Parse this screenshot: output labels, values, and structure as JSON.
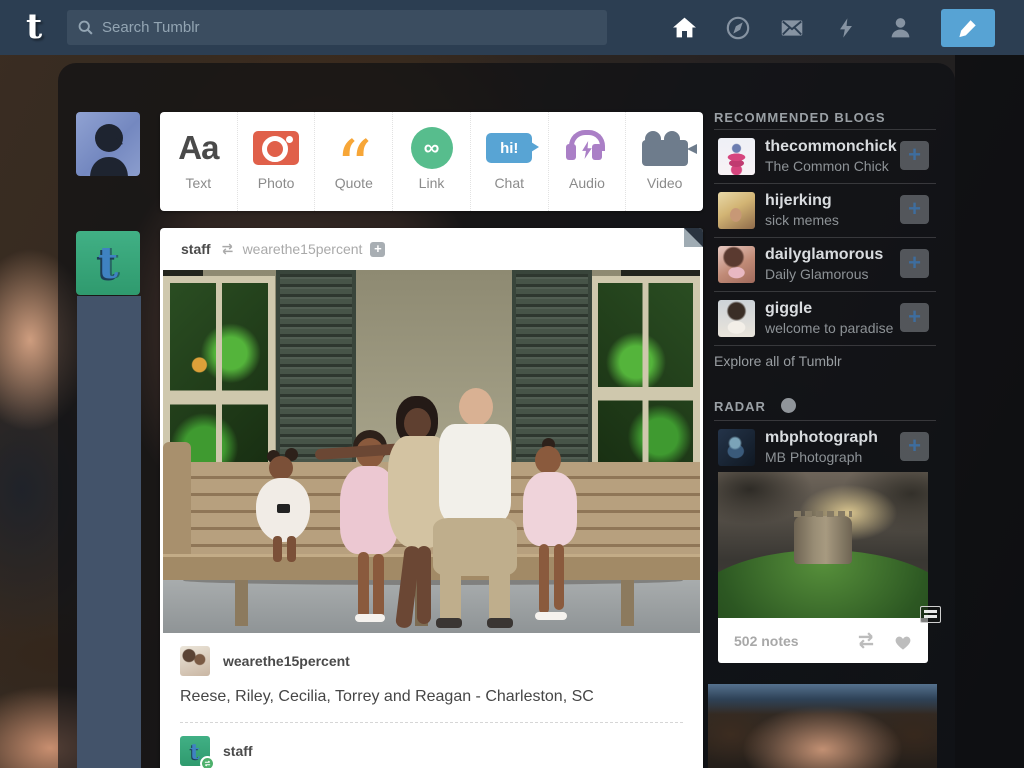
{
  "nav": {
    "logo_glyph": "t",
    "search": {
      "placeholder": "Search Tumblr"
    },
    "icons": [
      "home-icon",
      "compass-icon",
      "envelope-icon",
      "lightning-icon",
      "person-icon",
      "pencil-compose-icon"
    ],
    "colors": {
      "bar": "#2c3e52",
      "compose_button": "#57a3d4"
    }
  },
  "composer": {
    "types": [
      {
        "label": "Text",
        "color": "#4a4a4a"
      },
      {
        "label": "Photo",
        "color": "#e0604a"
      },
      {
        "label": "Quote",
        "color": "#f7a637"
      },
      {
        "label": "Link",
        "color": "#57bd8d"
      },
      {
        "label": "Chat",
        "color": "#58a4d4",
        "bubble_text": "hi!"
      },
      {
        "label": "Audio",
        "color": "#aa7fc6"
      },
      {
        "label": "Video",
        "color": "#6e7c8c"
      }
    ]
  },
  "post": {
    "reblogger": "staff",
    "source_blog": "wearethe15percent",
    "follow_plus": "+",
    "caption_author": "wearethe15percent",
    "caption": "Reese, Riley, Cecilia, Torrey and Reagan - Charleston, SC",
    "reblog_commenter": "staff",
    "link_glyph": "∞"
  },
  "sidebar": {
    "recommended_title": "RECOMMENDED BLOGS",
    "follow_plus": "+",
    "blogs": [
      {
        "name": "thecommonchick",
        "description": "The Common Chick"
      },
      {
        "name": "hijerking",
        "description": "sick memes"
      },
      {
        "name": "dailyglamorous",
        "description": "Daily Glamorous"
      },
      {
        "name": "giggle",
        "description": "welcome to paradise"
      }
    ],
    "explore_link": "Explore all of Tumblr",
    "radar": {
      "title": "RADAR",
      "blog_name": "mbphotograph",
      "blog_description": "MB Photograph",
      "notes": "502 notes"
    }
  }
}
